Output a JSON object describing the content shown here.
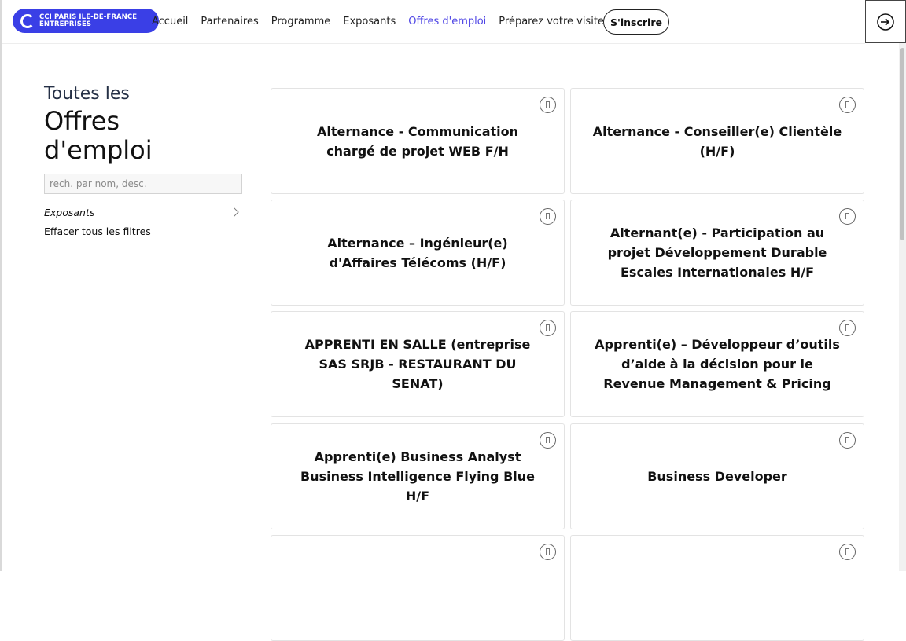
{
  "header": {
    "logo_line1": "CCI PARIS ILE-DE-FRANCE",
    "logo_line2": "ENTREPRISES",
    "nav": [
      "Accueil",
      "Partenaires",
      "Programme",
      "Exposants",
      "Offres d'emploi",
      "Préparez votre visite"
    ],
    "active_nav": "Offres d'emploi",
    "signup_label": "S'inscrire",
    "login_icon": "sign-in-icon"
  },
  "sidebar": {
    "title_small": "Toutes les",
    "title_big_line1": "Offres",
    "title_big_line2": "d'emploi",
    "search_placeholder": "rech. par nom, desc.",
    "filter_exhibitors": "Exposants",
    "clear_filters": "Effacer tous les filtres"
  },
  "jobs": [
    "Alternance - Communication chargé de projet WEB F/H",
    "Alternance - Conseiller(e) Clientèle (H/F)",
    "Alternance – Ingénieur(e) d'Affaires Télécoms (H/F)",
    "Alternant(e) - Participation au projet Développement Durable Escales Internationales H/F",
    "APPRENTI EN SALLE (entreprise SAS SRJB - RESTAURANT DU SENAT)",
    "Apprenti(e) – Développeur d’outils d’aide à la décision pour le Revenue Management & Pricing",
    "Apprenti(e) Business Analyst Business Intelligence Flying Blue H/F",
    "Business Developer",
    "",
    ""
  ],
  "colors": {
    "brand": "#3a3fe6",
    "active_nav": "#4f46e5"
  }
}
